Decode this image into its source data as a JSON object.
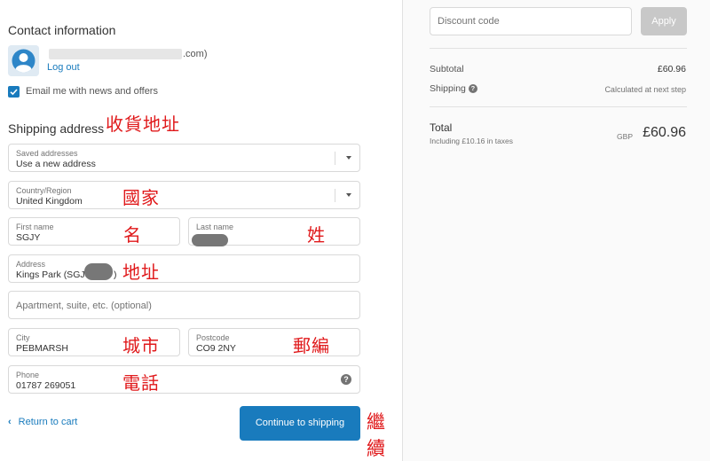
{
  "contact": {
    "title": "Contact information",
    "email_suffix": ".com)",
    "logout": "Log out",
    "newsletter_label": "Email me with news and offers",
    "newsletter_checked": true
  },
  "shipping": {
    "title": "Shipping address",
    "saved_addresses": {
      "label": "Saved addresses",
      "value": "Use a new address"
    },
    "country": {
      "label": "Country/Region",
      "value": "United Kingdom"
    },
    "first_name": {
      "label": "First name",
      "value": "SGJY"
    },
    "last_name": {
      "label": "Last name",
      "value": ""
    },
    "address": {
      "label": "Address",
      "value": "Kings Park (SGJY",
      "suffix": ")"
    },
    "apartment": {
      "placeholder": "Apartment, suite, etc. (optional)"
    },
    "city": {
      "label": "City",
      "value": "PEBMARSH"
    },
    "postcode": {
      "label": "Postcode",
      "value": "CO9 2NY"
    },
    "phone": {
      "label": "Phone",
      "value": "01787 269051"
    }
  },
  "annotations": {
    "shipping_address": "收貨地址",
    "country": "國家",
    "first_name": "名",
    "last_name": "姓",
    "address": "地址",
    "city": "城市",
    "postcode": "郵編",
    "phone": "電話",
    "continue": "繼續"
  },
  "nav": {
    "return": "Return to cart",
    "continue": "Continue to shipping"
  },
  "summary": {
    "discount_placeholder": "Discount code",
    "apply": "Apply",
    "subtotal_label": "Subtotal",
    "subtotal_value": "£60.96",
    "shipping_label": "Shipping",
    "shipping_value": "Calculated at next step",
    "total_label": "Total",
    "tax_note": "Including £10.16 in taxes",
    "currency": "GBP",
    "total_value": "£60.96"
  },
  "colors": {
    "accent": "#197bbd",
    "annotation": "#e0191b",
    "redaction": "#777777"
  },
  "icons": [
    "user-avatar-icon",
    "check-icon",
    "chevron-down-icon",
    "question-circle-icon",
    "chevron-left-icon"
  ]
}
